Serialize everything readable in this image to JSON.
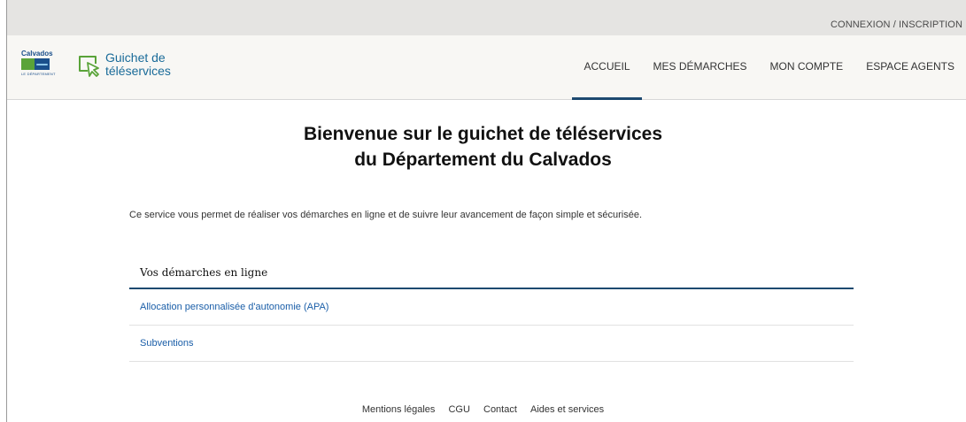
{
  "topbar": {
    "login_link": "CONNEXION / INSCRIPTION"
  },
  "header": {
    "logo": {
      "brand": "Calvados",
      "sub": "LE DÉPARTEMENT"
    },
    "app_name_line1": "Guichet de",
    "app_name_line2": "téléservices",
    "nav": [
      {
        "label": "ACCUEIL",
        "active": true
      },
      {
        "label": "MES DÉMARCHES"
      },
      {
        "label": "MON COMPTE"
      },
      {
        "label": "ESPACE AGENTS"
      }
    ]
  },
  "main": {
    "title_line1": "Bienvenue sur le guichet de téléservices",
    "title_line2": "du Département du Calvados",
    "intro": "Ce service vous permet de réaliser vos démarches en ligne et de suivre leur avancement de façon simple et sécurisée.",
    "panel": {
      "heading": "Vos démarches en ligne",
      "items": [
        {
          "label": "Allocation personnalisée d'autonomie (APA)"
        },
        {
          "label": "Subventions"
        }
      ]
    }
  },
  "footer": {
    "links": [
      {
        "label": "Mentions légales"
      },
      {
        "label": "CGU"
      },
      {
        "label": "Contact"
      },
      {
        "label": "Aides et services"
      }
    ]
  },
  "colors": {
    "accent": "#1d4970",
    "link": "#1a5ea8",
    "brand_green": "#5aa339",
    "brand_blue": "#1a4f8b"
  }
}
